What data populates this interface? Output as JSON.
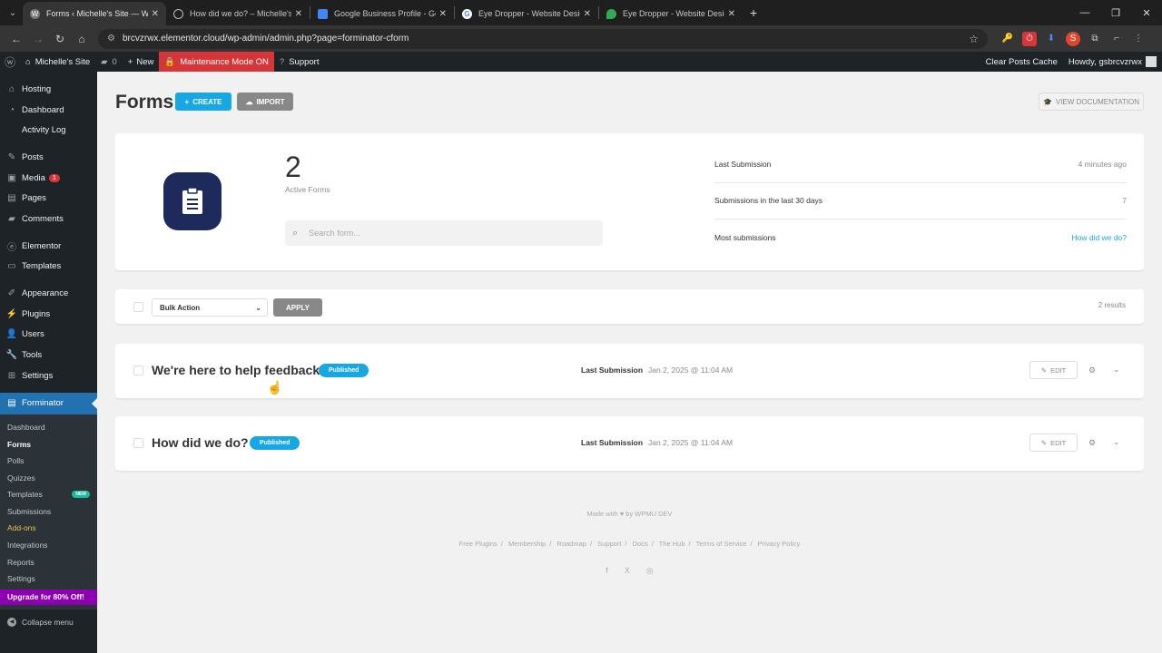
{
  "browser": {
    "tabs": [
      {
        "label": "Forms ‹ Michelle's Site — WordPress",
        "active": true
      },
      {
        "label": "How did we do? – Michelle's Site",
        "active": false
      },
      {
        "label": "Google Business Profile - Get Listed",
        "active": false
      },
      {
        "label": "Eye Dropper - Website Design & Color",
        "active": false
      },
      {
        "label": "Eye Dropper - Website Design & Color",
        "active": false
      }
    ],
    "url": "brcvzrwx.elementor.cloud/wp-admin/admin.php?page=forminator-cform",
    "new_tab_symbol": "+"
  },
  "adminbar": {
    "site_name": "Michelle's Site",
    "comments_count": "0",
    "new_label": "New",
    "maintenance_label": "Maintenance Mode ON",
    "support_label": "Support",
    "clear_cache_label": "Clear Posts Cache",
    "howdy_label": "Howdy, gsbrcvzrwx"
  },
  "sidebar": {
    "items": [
      {
        "label": "Hosting",
        "icon": "home-icon"
      },
      {
        "label": "Dashboard",
        "icon": "dashboard-icon"
      },
      {
        "label": "Activity Log",
        "icon": "activity-icon"
      },
      {
        "label": "Posts",
        "icon": "pin-icon"
      },
      {
        "label": "Media",
        "icon": "media-icon",
        "badge": "1"
      },
      {
        "label": "Pages",
        "icon": "pages-icon"
      },
      {
        "label": "Comments",
        "icon": "comments-icon"
      },
      {
        "label": "Elementor",
        "icon": "elementor-icon"
      },
      {
        "label": "Templates",
        "icon": "folder-icon"
      },
      {
        "label": "Appearance",
        "icon": "brush-icon"
      },
      {
        "label": "Plugins",
        "icon": "plugin-icon"
      },
      {
        "label": "Users",
        "icon": "users-icon"
      },
      {
        "label": "Tools",
        "icon": "wrench-icon"
      },
      {
        "label": "Settings",
        "icon": "settings-icon"
      }
    ],
    "current": {
      "label": "Forminator",
      "icon": "forminator-icon"
    },
    "submenu": [
      {
        "label": "Dashboard"
      },
      {
        "label": "Forms"
      },
      {
        "label": "Polls"
      },
      {
        "label": "Quizzes"
      },
      {
        "label": "Templates",
        "badge": "NEW"
      },
      {
        "label": "Submissions"
      },
      {
        "label": "Add-ons"
      },
      {
        "label": "Integrations"
      },
      {
        "label": "Reports"
      },
      {
        "label": "Settings"
      }
    ],
    "upgrade_label": "Upgrade for 80% Off!",
    "collapse_label": "Collapse menu"
  },
  "main": {
    "title": "Forms",
    "create_label": "CREATE",
    "import_label": "IMPORT",
    "doc_label": "VIEW DOCUMENTATION",
    "summary": {
      "active_count": "2",
      "active_label": "Active Forms",
      "search_placeholder": "Search form...",
      "stats": [
        {
          "label": "Last Submission",
          "value": "4 minutes ago"
        },
        {
          "label": "Submissions in the last 30 days",
          "value": "7"
        },
        {
          "label": "Most submissions",
          "value": "How did we do?"
        }
      ]
    },
    "bulk": {
      "select_value": "Bulk Action",
      "apply_label": "APPLY",
      "results": "2 results"
    },
    "forms": [
      {
        "title": "We're here to help feedback",
        "status": "Published",
        "last_label": "Last Submission",
        "last_date": "Jan 2, 2025 @ 11:04 AM",
        "edit_label": "EDIT"
      },
      {
        "title": "How did we do?",
        "status": "Published",
        "last_label": "Last Submission",
        "last_date": "Jan 2, 2025 @ 11:04 AM",
        "edit_label": "EDIT"
      }
    ],
    "footer": {
      "made_prefix": "Made with",
      "made_suffix": "by WPMU DEV",
      "links": [
        "Free Plugins",
        "Membership",
        "Roadmap",
        "Support",
        "Docs",
        "The Hub",
        "Terms of Service",
        "Privacy Policy"
      ],
      "social": [
        "f",
        "X",
        "◎"
      ]
    }
  },
  "colors": {
    "accent": "#17a8e3",
    "wp_dark": "#1d2327",
    "wp_blue": "#2271b1",
    "maintenance_red": "#d63638",
    "upgrade_purple": "#8d00b1",
    "forminator_logo_bg": "#1d2a5b"
  }
}
